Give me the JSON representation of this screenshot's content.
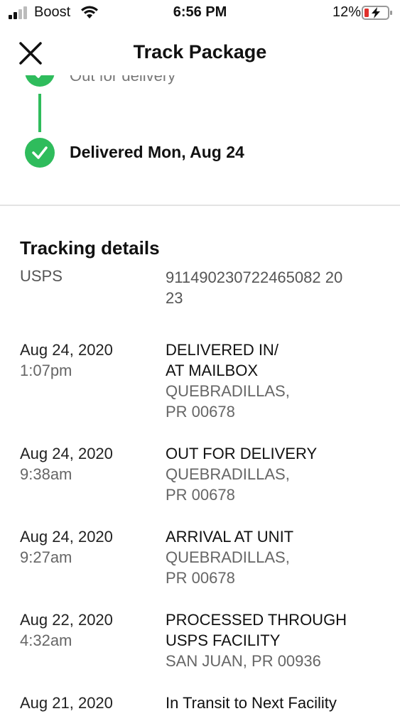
{
  "status_bar": {
    "carrier": "Boost",
    "time": "6:56 PM",
    "battery": "12%",
    "icons": [
      "signal-icon",
      "wifi-icon",
      "battery-charging-icon"
    ]
  },
  "header": {
    "title": "Track Package",
    "close_icon": "close-icon"
  },
  "timeline": {
    "previous_step": "Out for delivery",
    "current_step": "Delivered Mon, Aug 24",
    "accent_color": "#2fbc5c"
  },
  "tracking": {
    "section_title": "Tracking details",
    "carrier": "USPS",
    "number_line1": "911490230722465082 20",
    "number_line2": "23"
  },
  "events": [
    {
      "date": "Aug 24, 2020",
      "time": "1:07pm",
      "status_line1": "DELIVERED IN/",
      "status_line2": "AT MAILBOX",
      "location_line1": "QUEBRADILLAS,",
      "location_line2": "PR 00678"
    },
    {
      "date": "Aug 24, 2020",
      "time": "9:38am",
      "status_line1": "OUT FOR DELIVERY",
      "status_line2": "",
      "location_line1": "QUEBRADILLAS,",
      "location_line2": "PR 00678"
    },
    {
      "date": "Aug 24, 2020",
      "time": "9:27am",
      "status_line1": "ARRIVAL AT UNIT",
      "status_line2": "",
      "location_line1": "QUEBRADILLAS,",
      "location_line2": "PR 00678"
    },
    {
      "date": "Aug 22, 2020",
      "time": "4:32am",
      "status_line1": "PROCESSED THROUGH",
      "status_line2": "USPS FACILITY",
      "location_line1": "SAN JUAN, PR 00936",
      "location_line2": ""
    },
    {
      "date": "Aug 21, 2020",
      "time": "",
      "status_line1": "In Transit to Next Facility",
      "status_line2": "",
      "location_line1": "",
      "location_line2": ""
    }
  ]
}
